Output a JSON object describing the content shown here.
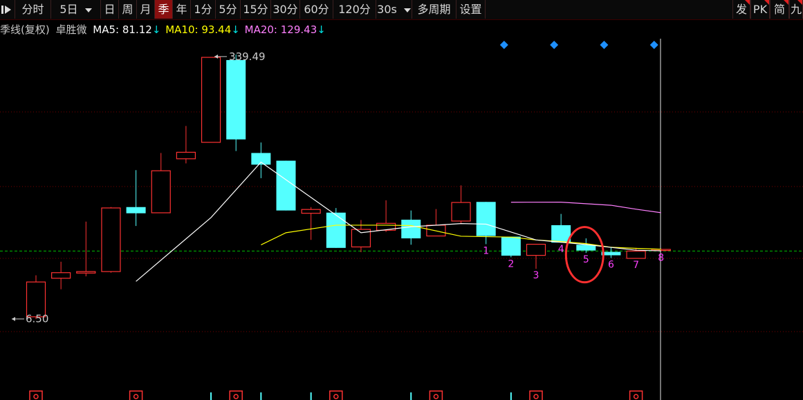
{
  "toolbar": {
    "toggle_icon": "panel-toggle-icon",
    "items": [
      {
        "label": "分时"
      },
      {
        "label": "5日",
        "dropdown": true
      },
      {
        "label": "日"
      },
      {
        "label": "周"
      },
      {
        "label": "月"
      },
      {
        "label": "季",
        "active": true
      },
      {
        "label": "年"
      },
      {
        "label": "1分"
      },
      {
        "label": "5分"
      },
      {
        "label": "15分"
      },
      {
        "label": "30分"
      },
      {
        "label": "60分"
      },
      {
        "label": "120分"
      },
      {
        "label": "30s",
        "dropdown": true
      },
      {
        "label": "多周期"
      },
      {
        "label": "设置"
      }
    ],
    "right_items": [
      {
        "label": "发"
      },
      {
        "label": "PK"
      },
      {
        "label": "简"
      },
      {
        "label": "九"
      }
    ]
  },
  "info": {
    "period": "季线(复权)",
    "stock": "卓胜微",
    "ma5_label": "MA5:",
    "ma5_value": "81.12",
    "ma10_label": "MA10:",
    "ma10_value": "93.44",
    "ma20_label": "MA20:",
    "ma20_value": "129.43",
    "down_arrow": "↓"
  },
  "colors": {
    "up": "#ff3232",
    "down": "#54ffff",
    "ma5": "#ffffff",
    "ma10": "#ffff00",
    "ma20": "#ff80ff",
    "label": "#ff40ff",
    "circle": "#ff3030",
    "diamond": "#1e90ff",
    "ref_line": "#00c000",
    "grid": "#7a0000"
  },
  "chart_data": {
    "type": "candlestick",
    "high_label": "339.49",
    "low_label": "6.50",
    "candles": [
      {
        "o": 9.2,
        "c": 53.1,
        "h": 61.5,
        "l": 6.5
      },
      {
        "o": 57.8,
        "c": 64.8,
        "h": 78.6,
        "l": 43.9
      },
      {
        "o": 64.3,
        "c": 66.2,
        "h": 129.1,
        "l": 60.2
      },
      {
        "o": 66.2,
        "c": 146.3,
        "h": 147.4,
        "l": 64.8
      },
      {
        "o": 147.4,
        "c": 139.6,
        "h": 193.9,
        "l": 123.6
      },
      {
        "o": 140.2,
        "c": 193.1,
        "h": 215.5,
        "l": 140.2
      },
      {
        "o": 208.2,
        "c": 216.4,
        "h": 249.5,
        "l": 202.4
      },
      {
        "o": 228.9,
        "c": 335.9,
        "h": 335.9,
        "l": 228.9
      },
      {
        "o": 332.5,
        "c": 232.6,
        "h": 339.5,
        "l": 217.9
      },
      {
        "o": 215.5,
        "c": 200.8,
        "h": 228.7,
        "l": 183.8
      },
      {
        "o": 205.8,
        "c": 143.1,
        "h": 205.8,
        "l": 143.1
      },
      {
        "o": 139.6,
        "c": 144.4,
        "h": 147.4,
        "l": 106.1
      },
      {
        "o": 140.4,
        "c": 96.0,
        "h": 146.2,
        "l": 96.0
      },
      {
        "o": 97.2,
        "c": 119.3,
        "h": 131.1,
        "l": 90.6
      },
      {
        "o": 118.2,
        "c": 126.9,
        "h": 155.9,
        "l": 116.1
      },
      {
        "o": 131.5,
        "c": 108.0,
        "h": 143.1,
        "l": 100.0
      },
      {
        "o": 111.0,
        "c": 124.6,
        "h": 144.9,
        "l": 111.0
      },
      {
        "o": 129.8,
        "c": 153.2,
        "h": 174.7,
        "l": 126.8
      },
      {
        "o": 153.9,
        "c": 111.0,
        "h": 153.9,
        "l": 100.7
      },
      {
        "o": 110.2,
        "c": 86.2,
        "h": 110.2,
        "l": 84.2
      },
      {
        "o": 86.6,
        "c": 100.6,
        "h": 100.6,
        "l": 69.6
      },
      {
        "o": 124.6,
        "c": 102.7,
        "h": 138.8,
        "l": 102.7
      },
      {
        "o": 100.0,
        "c": 92.7,
        "h": 108.0,
        "l": 89.6
      },
      {
        "o": 91.0,
        "c": 86.7,
        "h": 96.8,
        "l": 83.3
      },
      {
        "o": 82.8,
        "c": 92.0,
        "h": 96.0,
        "l": 82.8
      },
      {
        "o": 92.7,
        "c": 94.1,
        "h": 95.0,
        "l": 92.0
      }
    ],
    "ma5": [
      [
        4,
        53.8
      ],
      [
        7,
        134.2
      ],
      [
        9,
        204.0
      ],
      [
        13,
        115.1
      ],
      [
        15,
        122.6
      ],
      [
        17,
        126.6
      ],
      [
        18,
        125.9
      ],
      [
        20,
        106.0
      ],
      [
        22,
        100.2
      ],
      [
        24,
        93.1
      ],
      [
        25,
        92.3
      ]
    ],
    "ma10": [
      [
        9,
        99.8
      ],
      [
        10,
        115.1
      ],
      [
        12,
        124.6
      ],
      [
        14,
        124.6
      ],
      [
        15,
        124.1
      ],
      [
        17,
        110.7
      ],
      [
        19,
        109.6
      ],
      [
        20,
        106.0
      ],
      [
        21,
        104.0
      ],
      [
        22,
        101.4
      ],
      [
        23,
        96.8
      ],
      [
        24,
        95.4
      ],
      [
        25,
        94.3
      ]
    ],
    "ma20": [
      [
        19,
        153.5
      ],
      [
        21,
        153.6
      ],
      [
        23,
        149.7
      ],
      [
        24,
        144.7
      ],
      [
        25,
        140.3
      ]
    ],
    "ref_price": 92.0,
    "wave_labels": [
      {
        "candle": 18,
        "text": "1",
        "pos": "below"
      },
      {
        "candle": 19,
        "text": "2",
        "pos": "below"
      },
      {
        "candle": 20,
        "text": "3",
        "pos": "below"
      },
      {
        "candle": 21,
        "text": "4",
        "pos": "below"
      },
      {
        "candle": 22,
        "text": "5",
        "pos": "below"
      },
      {
        "candle": 23,
        "text": "6",
        "pos": "below"
      },
      {
        "candle": 24,
        "text": "7",
        "pos": "below"
      },
      {
        "candle": 25,
        "text": "8",
        "pos": "below"
      }
    ],
    "highlight_candle": 22,
    "diamonds_at": [
      19,
      21,
      23,
      25
    ],
    "volume_markers": [
      {
        "candle": 0,
        "kind": "flag"
      },
      {
        "candle": 4,
        "kind": "flag"
      },
      {
        "candle": 7,
        "kind": "tick"
      },
      {
        "candle": 8,
        "kind": "flag"
      },
      {
        "candle": 9,
        "kind": "tick"
      },
      {
        "candle": 11,
        "kind": "tick"
      },
      {
        "candle": 12,
        "kind": "flag"
      },
      {
        "candle": 15,
        "kind": "tick"
      },
      {
        "candle": 16,
        "kind": "flag"
      },
      {
        "candle": 19,
        "kind": "tick"
      },
      {
        "candle": 20,
        "kind": "flag"
      },
      {
        "candle": 24,
        "kind": "flag"
      }
    ]
  }
}
